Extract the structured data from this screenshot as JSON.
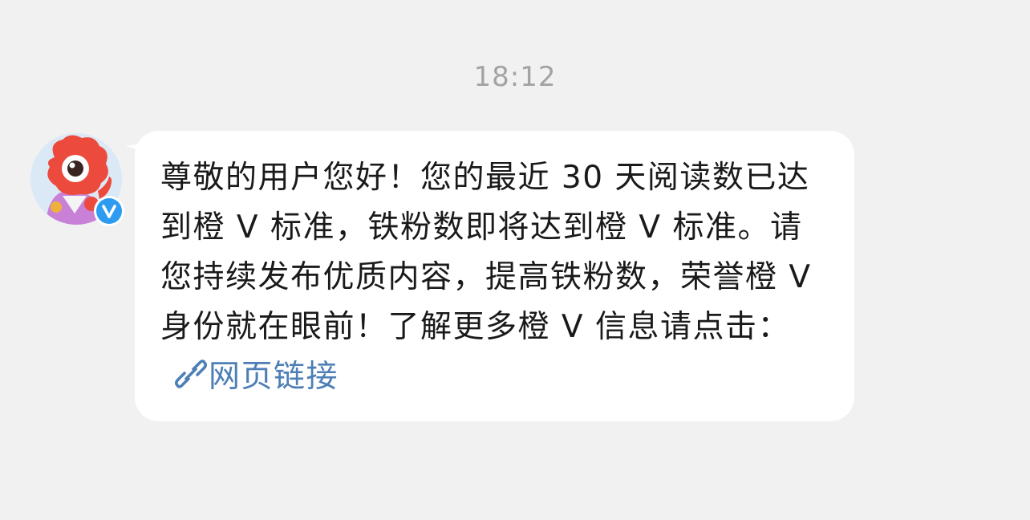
{
  "timestamp": "18:12",
  "sender": {
    "verified_mark": "V"
  },
  "message": {
    "text": "尊敬的用户您好！您的最近 30 天阅读数已达到橙 V 标准，铁粉数即将达到橙 V 标准。请您持续发布优质内容，提高铁粉数，荣誉橙 V 身份就在眼前！了解更多橙 V 信息请点击：",
    "link_label": "网页链接",
    "link_icon": "link-icon"
  },
  "colors": {
    "background": "#f1f1f1",
    "bubble": "#ffffff",
    "link": "#4d7fb6",
    "verified_badge": "#2d9cf0",
    "avatar_mascot": "#ec4a3c"
  }
}
